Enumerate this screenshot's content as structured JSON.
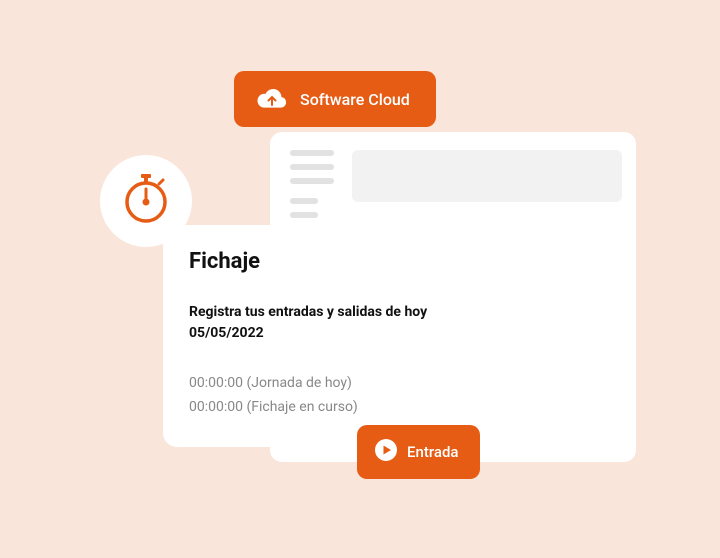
{
  "cloud_badge": {
    "label": "Software Cloud"
  },
  "card": {
    "title": "Fichaje",
    "subtitle_line1": "Registra tus entradas y salidas de hoy",
    "subtitle_line2": "05/05/2022",
    "time_today": "00:00:00 (Jornada de hoy)",
    "time_current": "00:00:00 (Fichaje en curso)"
  },
  "entrada_button": {
    "label": "Entrada"
  },
  "colors": {
    "accent": "#e65c14",
    "background": "#fae5da"
  }
}
